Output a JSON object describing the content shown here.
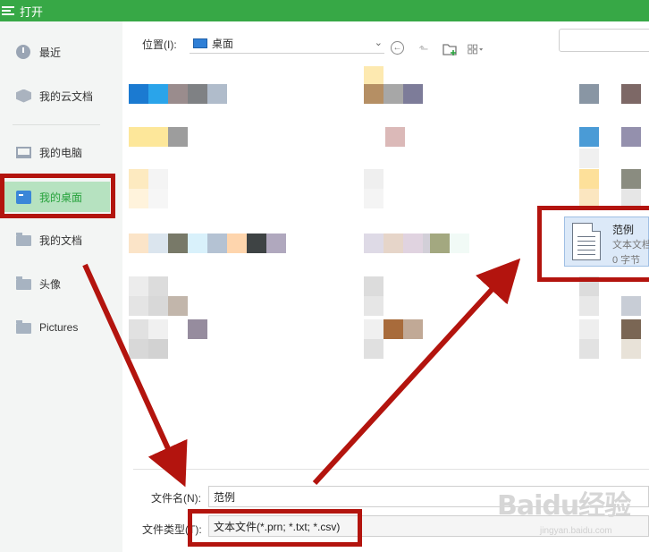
{
  "window": {
    "title": "打开"
  },
  "sidebar": {
    "items": [
      {
        "label": "最近"
      },
      {
        "label": "我的云文档"
      },
      {
        "label": "我的电脑"
      },
      {
        "label": "我的桌面"
      },
      {
        "label": "我的文档"
      },
      {
        "label": "头像"
      },
      {
        "label": "Pictures"
      }
    ],
    "selected": "我的桌面"
  },
  "toolbar": {
    "location_label": "位置(I):",
    "location_value": "桌面",
    "icons": [
      "back-icon",
      "up-folder-icon",
      "new-folder-icon",
      "view-mode-icon"
    ]
  },
  "selected_file": {
    "name": "范例",
    "type": "文本文档",
    "size": "0 字节"
  },
  "form": {
    "filename_label": "文件名(N):",
    "filename_value": "范例",
    "filetype_label": "文件类型(T):",
    "filetype_value": "文本文件(*.prn; *.txt; *.csv)"
  },
  "watermark": {
    "brand": "Baidu经验",
    "url": "jingyan.baidu.com"
  },
  "colors": {
    "titlebar": "#37a846",
    "selected_bg": "#b6e2c0",
    "annotation": "#b3140e"
  }
}
